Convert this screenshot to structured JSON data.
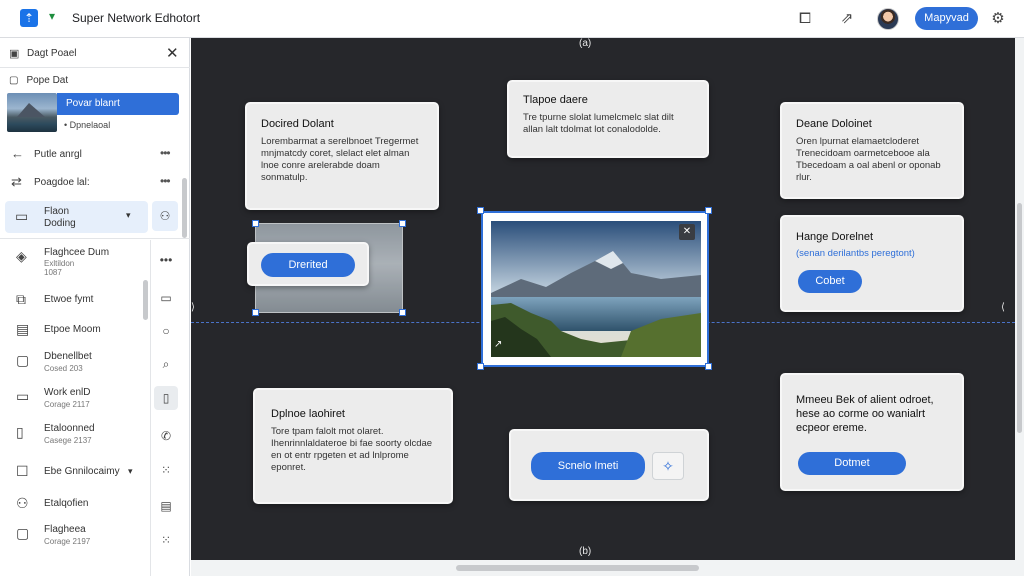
{
  "app": {
    "title": "Super Network Edhotort",
    "primary_button": "Mapyvad"
  },
  "topbar": {
    "icons": [
      "frame-icon",
      "share-icon",
      "avatar",
      "settings-icon"
    ]
  },
  "sidebar": {
    "panel_title": "Dagt Poael",
    "page_label": "Pope Dat",
    "selected_page": "Povar blanrt",
    "selected_page_sub": "Dpnelaoal",
    "rows": [
      {
        "label": "Putle anrgl",
        "icon": "arrow-left-icon"
      },
      {
        "label": "Poagdoe lal:",
        "icon": "arrows-swap-icon"
      }
    ],
    "selected_row": {
      "line1": "Flaon",
      "line2": "Doding"
    },
    "items": [
      {
        "title": "Flaghcee Dum",
        "sub1": "Exltildon",
        "sub2": "1087",
        "icon": "layers-icon"
      },
      {
        "title": "Etwoe fymt",
        "sub2": "",
        "icon": "copy-icon"
      },
      {
        "title": "Etpoe Moom",
        "sub2": "",
        "icon": "stack-icon"
      },
      {
        "title": "Dbenellbet",
        "sub2": "Cosed 203",
        "icon": "frame-icon"
      },
      {
        "title": "Work enlD",
        "sub2": "Corage 2117",
        "icon": "monitor-icon"
      },
      {
        "title": "Etaloonned",
        "sub2": "Casege 2137",
        "icon": "book-icon"
      },
      {
        "title": "Ebe Gnnilocaimy",
        "sub2": "",
        "icon": "checkbox-icon"
      },
      {
        "title": "Etalqofien",
        "sub2": "",
        "icon": "nodes-icon"
      },
      {
        "title": "Flagheea",
        "sub2": "Corage 2197",
        "icon": "frame-icon"
      }
    ],
    "tools": [
      "comment-icon",
      "circle-icon",
      "search-icon",
      "clipboard-icon",
      "phone-icon",
      "grid-dots-icon",
      "page-icon",
      "grid-dots-icon"
    ]
  },
  "canvas": {
    "edge_labels": [
      "(a)",
      "(b)"
    ],
    "card_tl": {
      "title": "Docired Dolant",
      "body": "Lorembarmat a serelbnoet Tregermet mnjmatcdy coret, slelact elet alman lnoe conre arelerabde doam sonmatulp."
    },
    "card_tc": {
      "title": "Tlapoe daere",
      "body": "Tre tpurne slolat lumelcmelc slat dilt allan lalt tdolmat lot conalodolde."
    },
    "card_tr": {
      "title": "Deane Doloinet",
      "body": "Oren lpurnat elamaetcloderet Trenecidoam oarmetcebooe ala Tbecedoam a oal abenl or oponab rlur."
    },
    "float_button": "Drerited",
    "card_mr": {
      "title": "Hange Dorelnet",
      "link": "(senan derilantbs peregtont)",
      "button": "Cobet"
    },
    "card_bl": {
      "title": "Dplnoe laohiret",
      "body": "Tore tpam falolt mot olaret. Ihenrinnlaldateroe bi fae soorty olcdae en ot entr rpgeten et ad lnlprome eponret."
    },
    "card_bc": {
      "button": "Scnelo Imeti"
    },
    "card_br": {
      "title": "Mmeeu Bek of alient odroet, hese ao corme oo wanialrt ecpeor ereme.",
      "button": "Dotmet"
    }
  }
}
